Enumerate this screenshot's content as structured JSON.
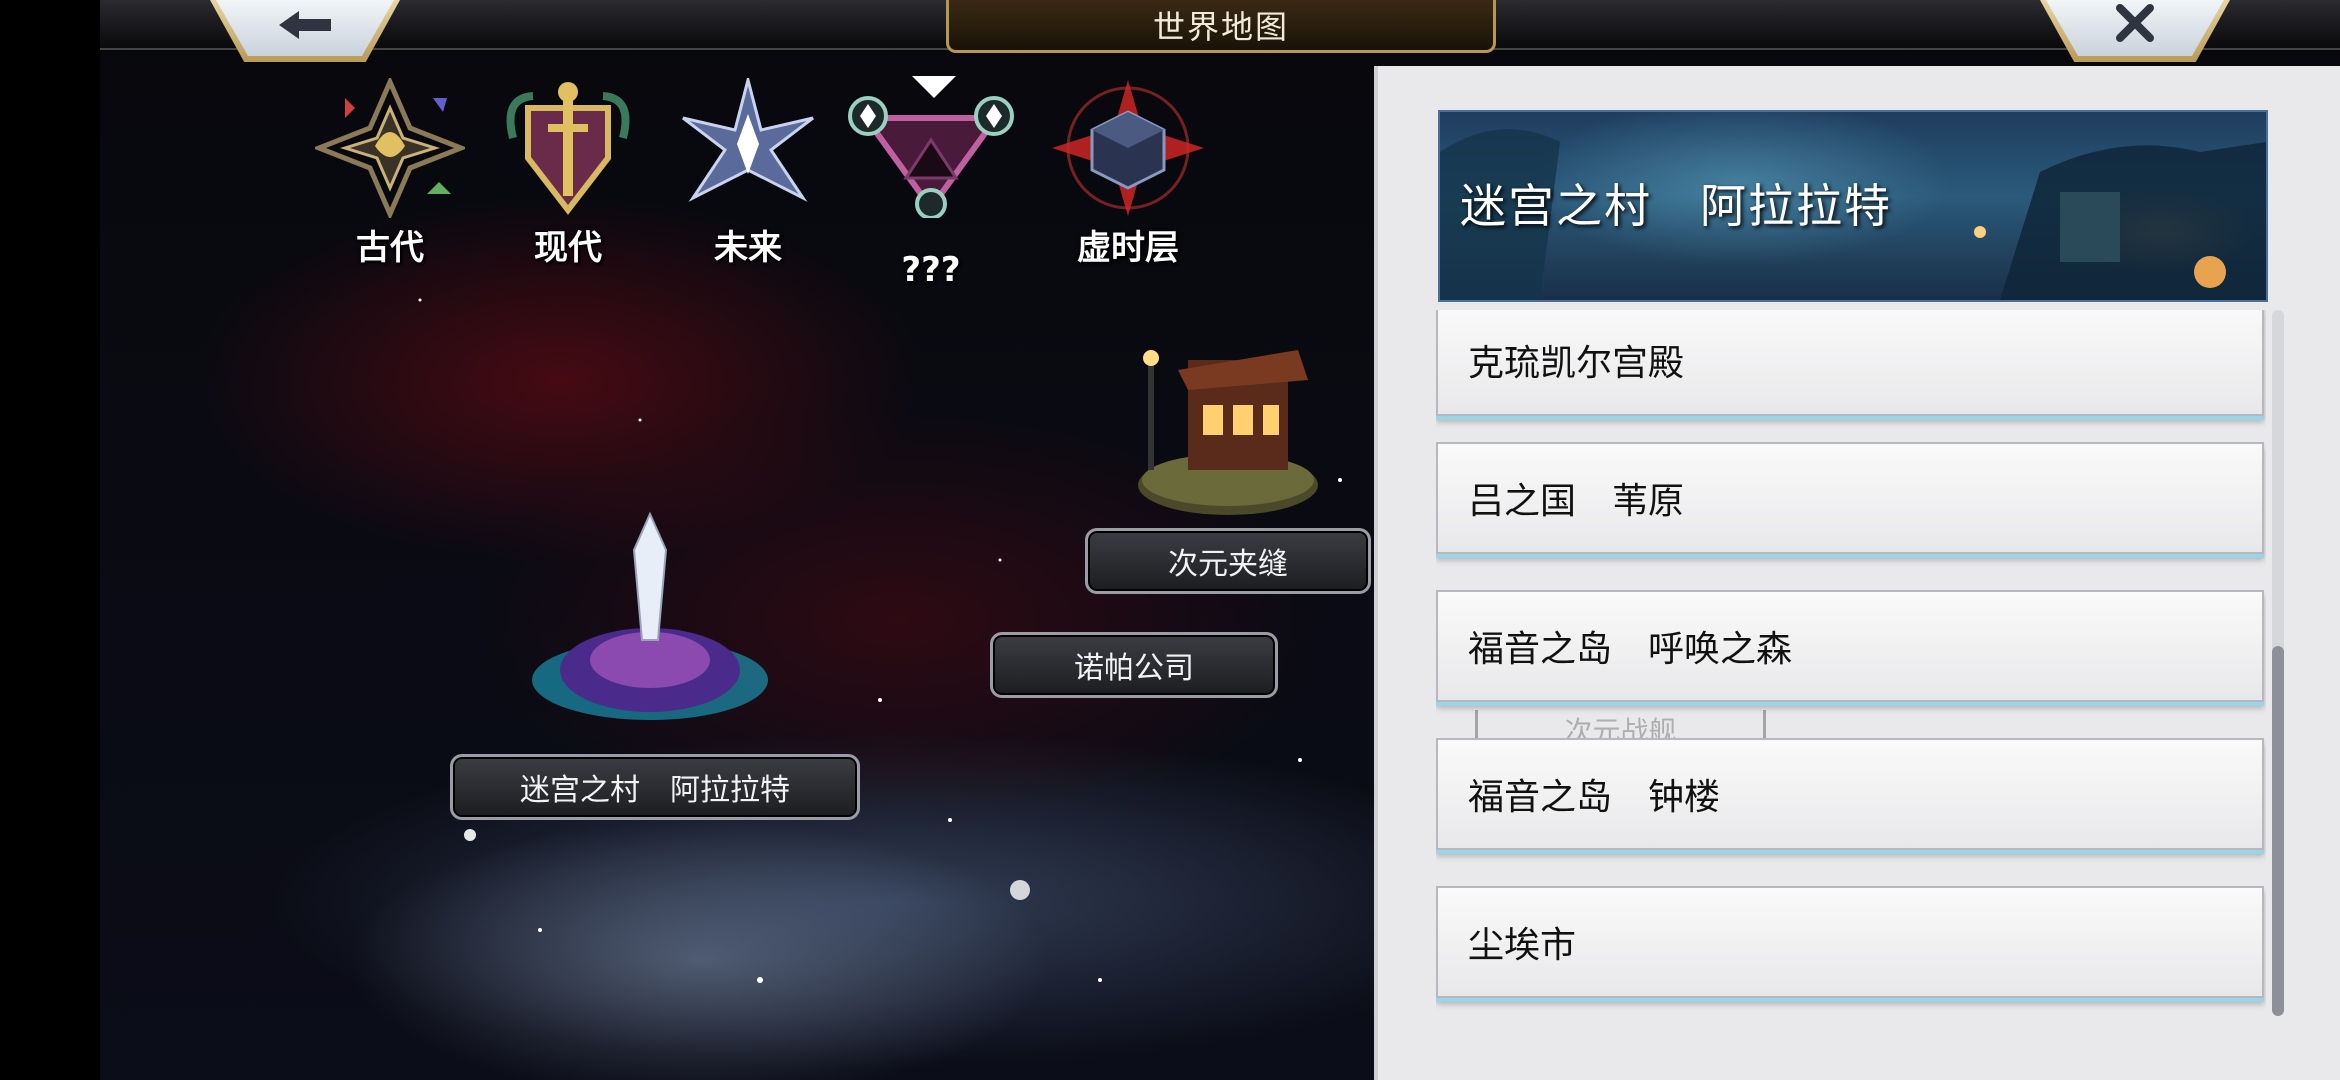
{
  "header": {
    "title": "世界地图",
    "back_icon": "back-arrow-icon",
    "close_icon": "close-icon"
  },
  "eras": [
    {
      "label": "古代",
      "icon": "ancient-emblem-icon"
    },
    {
      "label": "现代",
      "icon": "modern-shield-icon"
    },
    {
      "label": "未来",
      "icon": "future-star-icon"
    },
    {
      "label": "???",
      "icon": "unknown-triangle-icon"
    },
    {
      "label": "虚时层",
      "icon": "void-cube-icon"
    }
  ],
  "map_locations": {
    "dimension_rift": "次元夹缝",
    "nopa_company": "诺帕公司",
    "labyrinth_village": "迷宫之村　阿拉拉特"
  },
  "panel": {
    "banner_title": "迷宫之村　阿拉拉特",
    "items": [
      {
        "label": "克琉凯尔宫殿"
      },
      {
        "label": "吕之国　苇原"
      },
      {
        "label": "福音之岛　呼唤之森"
      },
      {
        "label": "福音之岛　钟楼"
      },
      {
        "label": "尘埃市"
      }
    ],
    "ghost_label": "次元战舰"
  },
  "colors": {
    "accent_gold": "#b89850",
    "panel_bg": "#e9e9ec",
    "item_glow": "#9ad4e6"
  }
}
